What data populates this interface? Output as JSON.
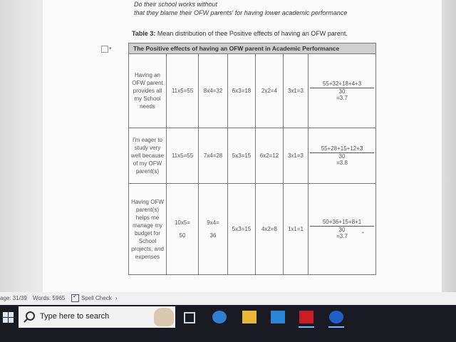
{
  "document": {
    "fragment_line1": "Do their school works without",
    "fragment_line2": "that they blame their OFW parents' for having lower academic performance",
    "caption_label": "Table 3:",
    "caption_text": " Mean distribution of thee Positive effects of having an OFW parent."
  },
  "table": {
    "header": "The Positive effects of having an OFW parent in Academic Performance",
    "rows": [
      {
        "statement": "Having an OFW parent provides all my School needs",
        "cells": [
          "11x5=55",
          "8x4=32",
          "6x3=18",
          "2x2=4",
          "3x1=3"
        ],
        "mean_num": "55+32+18+4+3",
        "mean_den": "30",
        "mean_val": "=3.7"
      },
      {
        "statement": "I'm eager to study very well because of my OFW parent(s)",
        "cells": [
          "11x5=55",
          "7x4=28",
          "5x3=15",
          "6x2=12",
          "3x1=3"
        ],
        "mean_num": "55+28+15+12+3",
        "mean_den": "30",
        "mean_val": "=3.8"
      },
      {
        "statement": "Having OFW parent(s) helps me manage my budget for School projects, and expenses",
        "cells": [
          "10x5=\n\n50",
          "9x4=\n\n36",
          "5x3=15",
          "4x2=8",
          "1x1=1"
        ],
        "mean_num": "50+36+15+8+1",
        "mean_den": "30",
        "mean_val": "=3.7"
      }
    ]
  },
  "statusbar": {
    "page": "age: 31/39",
    "words": "Words: 5965",
    "spell": "Spell Check"
  },
  "taskbar": {
    "search_placeholder": "Type here to search"
  }
}
